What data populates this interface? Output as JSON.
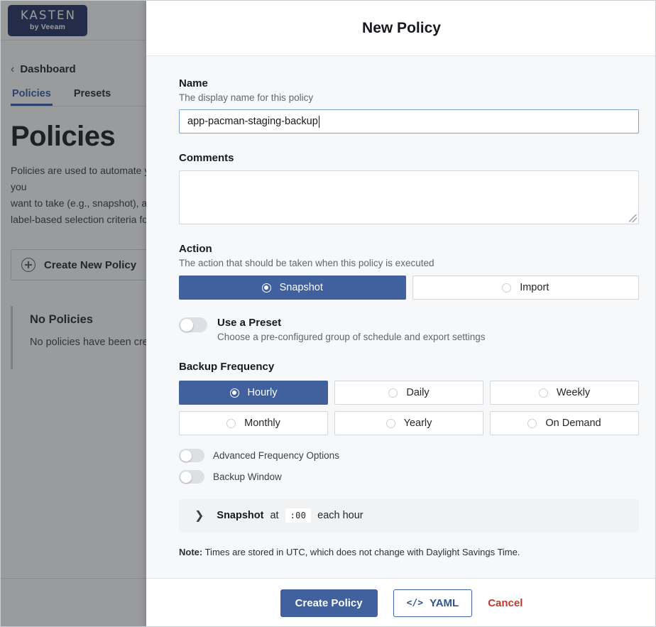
{
  "background": {
    "logo": {
      "main": "KASTEN",
      "sub": "by Veeam"
    },
    "breadcrumb": {
      "chevron": "‹",
      "label": "Dashboard"
    },
    "tabs": [
      {
        "label": "Policies",
        "active": true
      },
      {
        "label": "Presets",
        "active": false
      }
    ],
    "page_title": "Policies",
    "page_description": "Policies are used to automate your data management workflows. To achieve this, they combine actions you\nwant to take (e.g., snapshot), a frequency or schedule for how often you want to take that action, and\nlabel-based selection criteria for the resources you want to manage.",
    "create_button": {
      "label": "Create New Policy",
      "icon": "plus-circle-icon"
    },
    "empty_state": {
      "title": "No Policies",
      "subtitle": "No policies have been created yet."
    }
  },
  "modal": {
    "title": "New Policy",
    "name": {
      "label": "Name",
      "hint": "The display name for this policy",
      "value": "app-pacman-staging-backup",
      "placeholder": ""
    },
    "comments": {
      "label": "Comments",
      "value": "",
      "placeholder": ""
    },
    "action": {
      "label": "Action",
      "hint": "The action that should be taken when this policy is executed",
      "options": [
        {
          "label": "Snapshot",
          "selected": true
        },
        {
          "label": "Import",
          "selected": false
        }
      ]
    },
    "preset": {
      "label": "Use a Preset",
      "hint": "Choose a pre-configured group of schedule and export settings",
      "enabled": false
    },
    "backup_frequency": {
      "label": "Backup Frequency",
      "options": [
        {
          "label": "Hourly",
          "selected": true
        },
        {
          "label": "Daily",
          "selected": false
        },
        {
          "label": "Weekly",
          "selected": false
        },
        {
          "label": "Monthly",
          "selected": false
        },
        {
          "label": "Yearly",
          "selected": false
        },
        {
          "label": "On Demand",
          "selected": false
        }
      ]
    },
    "advanced_toggles": [
      {
        "label": "Advanced Frequency Options",
        "enabled": false
      },
      {
        "label": "Backup Window",
        "enabled": false
      }
    ],
    "schedule": {
      "chevron": "❯",
      "action_name": "Snapshot",
      "at_word": "at",
      "time": ":00",
      "suffix": "each hour"
    },
    "note": {
      "prefix": "Note:",
      "text": " Times are stored in UTC, which does not change with Daylight Savings Time."
    },
    "footer": {
      "create_label": "Create Policy",
      "yaml_icon": "</>",
      "yaml_label": "YAML",
      "cancel_label": "Cancel"
    }
  },
  "colors": {
    "accent_blue": "#40619e",
    "tab_blue": "#2f5aa8",
    "cancel_red": "#c0392b",
    "logo_navy": "#1f3060"
  }
}
